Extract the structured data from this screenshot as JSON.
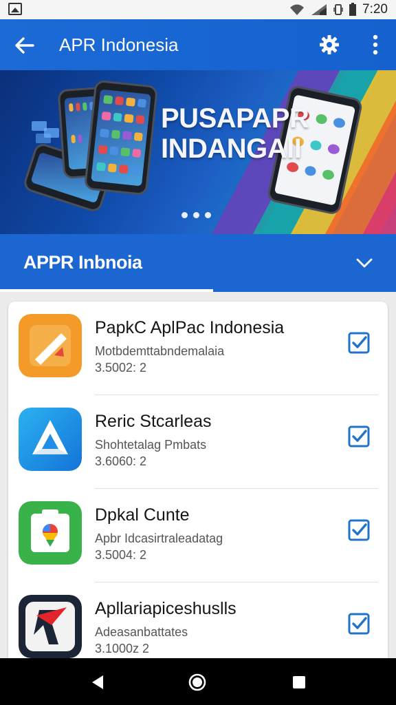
{
  "status_bar": {
    "time": "7:20",
    "icons": [
      "gallery-icon",
      "wifi-icon",
      "signal-icon",
      "vibrate-icon",
      "battery-icon"
    ]
  },
  "app_bar": {
    "title": "APR Indonesia",
    "icons": {
      "back": "arrow-left",
      "settings": "gear",
      "more": "vertical-dots"
    }
  },
  "banner": {
    "heading_line1": "PUSAPAPR",
    "heading_line2": "INDANGAII",
    "pagination_dots": 3
  },
  "section": {
    "label": "APPR Inbnoia",
    "chevron": "chevron-down"
  },
  "colors": {
    "app_bar": "#1b6ad6",
    "section_bar": "#1b66d0",
    "checkbox": "#1f74c9",
    "card_bg": "#ffffff"
  },
  "apps": [
    {
      "title": "PapkC AplPac Indonesia",
      "subtitle": "Motbdemttabndemalaia",
      "meta": "3.5002: 2",
      "icon": "orange-slash-app-icon",
      "checked": true
    },
    {
      "title": "Reric Stcarleas",
      "subtitle": "Shohtetalag Pmbats",
      "meta": "3.6060: 2",
      "icon": "blue-triangle-app-icon",
      "checked": true
    },
    {
      "title": "Dpkal Cunte",
      "subtitle": "Apbr Idcasirtraleadatag",
      "meta": "3.5004: 2",
      "icon": "green-maps-app-icon",
      "checked": true
    },
    {
      "title": "Apllariapiceshuslls",
      "subtitle": "Adeasanbattates",
      "meta": "3.1000z 2",
      "icon": "dark-red-check-app-icon",
      "checked": true
    }
  ],
  "nav_bar": {
    "icons": [
      "back-triangle",
      "home-circle",
      "recents-square"
    ]
  }
}
